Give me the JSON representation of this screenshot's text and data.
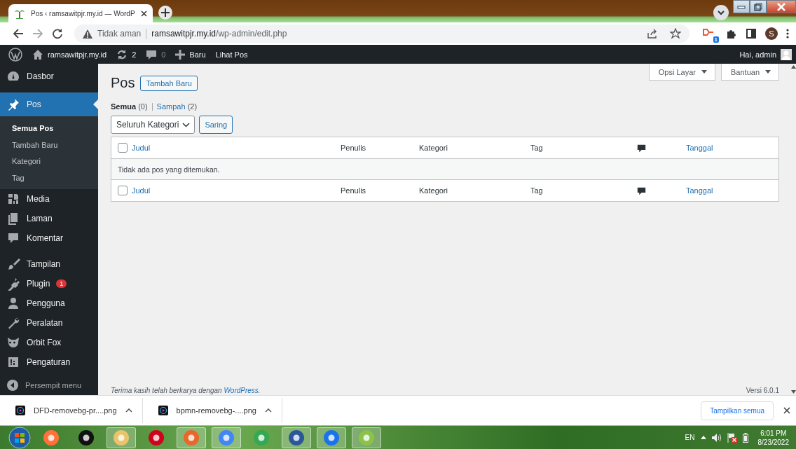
{
  "browser": {
    "tabs": [
      {
        "title": "Pos ‹ ramsawitpjr.my.id — WordP",
        "selected": true
      }
    ],
    "address": {
      "security": "Tidak aman",
      "domain": "ramsawitpjr.my.id",
      "path": "/wp-admin/edit.php"
    },
    "extension_badge": "1",
    "profile_initial": "S"
  },
  "admin_bar": {
    "site": "ramsawitpjr.my.id",
    "updates": "2",
    "comments": "0",
    "new": "Baru",
    "view": "Lihat Pos",
    "greeting": "Hai, admin"
  },
  "sidebar": {
    "groups": [
      [
        {
          "label": "Dasbor",
          "selected": false
        }
      ],
      [
        {
          "label": "Pos",
          "selected": true,
          "children": [
            {
              "label": "Semua Pos",
              "selected": true
            },
            {
              "label": "Tambah Baru",
              "selected": false
            },
            {
              "label": "Kategori",
              "selected": false
            },
            {
              "label": "Tag",
              "selected": false
            }
          ]
        },
        {
          "label": "Media",
          "selected": false
        },
        {
          "label": "Laman",
          "selected": false
        },
        {
          "label": "Komentar",
          "selected": false
        }
      ],
      [
        {
          "label": "Tampilan",
          "selected": false
        },
        {
          "label": "Plugin",
          "selected": false,
          "badge": "1"
        },
        {
          "label": "Pengguna",
          "selected": false
        },
        {
          "label": "Peralatan",
          "selected": false
        },
        {
          "label": "Orbit Fox",
          "selected": false
        },
        {
          "label": "Pengaturan",
          "selected": false
        }
      ]
    ],
    "collapse": "Persempit menu"
  },
  "screen_tabs": [
    "Opsi Layar",
    "Bantuan"
  ],
  "page": {
    "title": "Pos",
    "add_new": "Tambah Baru",
    "views": [
      {
        "label": "Semua",
        "count": "(0)",
        "selected": true
      },
      {
        "label": "Sampah",
        "count": "(2)",
        "selected": false
      }
    ],
    "category_filter": "Seluruh Kategori",
    "filter_button": "Saring"
  },
  "table": {
    "header_columns": [
      {
        "kind": "text",
        "label": "Judul",
        "sortable": true
      },
      {
        "kind": "text",
        "label": "Penulis",
        "sortable": false
      },
      {
        "kind": "text",
        "label": "Kategori",
        "sortable": false
      },
      {
        "kind": "text",
        "label": "Tag",
        "sortable": false
      },
      {
        "kind": "comments"
      },
      {
        "kind": "text",
        "label": "Tanggal",
        "sortable": true
      }
    ],
    "header_checked": false,
    "footer_checked": false,
    "empty_message": "Tidak ada pos yang ditemukan.",
    "footer_columns": [
      {
        "kind": "text",
        "label": "Judul",
        "sortable": true
      },
      {
        "kind": "text",
        "label": "Penulis",
        "sortable": false
      },
      {
        "kind": "text",
        "label": "Kategori",
        "sortable": false
      },
      {
        "kind": "text",
        "label": "Tag",
        "sortable": false
      },
      {
        "kind": "comments"
      },
      {
        "kind": "text",
        "label": "Tanggal",
        "sortable": true
      }
    ]
  },
  "footer": {
    "thanks": "Terima kasih telah berkarya dengan",
    "link": "WordPress",
    "after": ".",
    "version": "Versi 6.0.1"
  },
  "downloads": {
    "items": [
      {
        "name": "DFD-removebg-pr....png"
      },
      {
        "name": "bpmn-removebg-....png"
      }
    ],
    "show_all": "Tampilkan semua"
  },
  "taskbar": {
    "apps": [
      {
        "open": false
      },
      {
        "open": false
      },
      {
        "open": true
      },
      {
        "open": false
      },
      {
        "open": true
      },
      {
        "open": true
      },
      {
        "open": false
      },
      {
        "open": true
      },
      {
        "open": true
      },
      {
        "open": true
      }
    ],
    "language": "EN",
    "time": "6:01 PM",
    "date": "8/23/2022"
  }
}
